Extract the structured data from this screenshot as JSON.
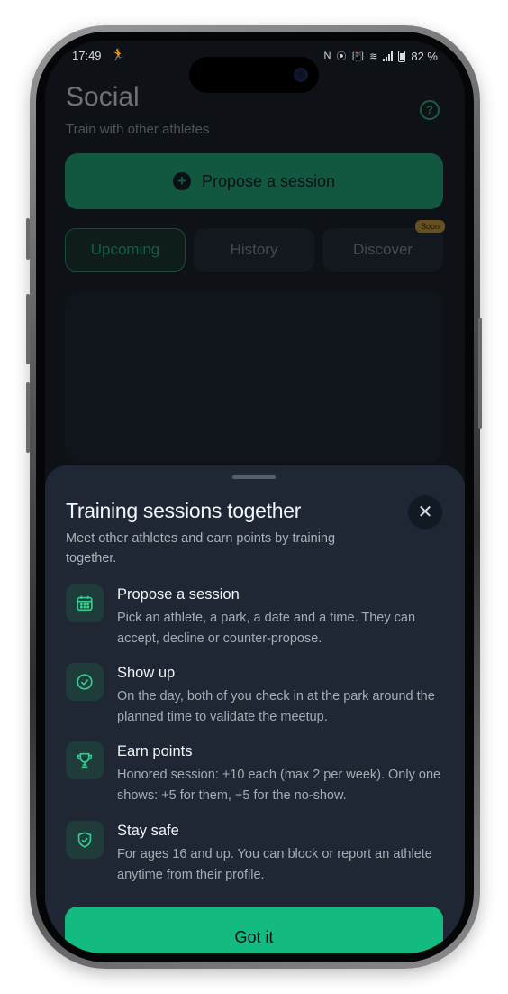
{
  "status_bar": {
    "time": "17:49",
    "runner_glyph": "🏃",
    "nfc_glyph": "N",
    "location_glyph": "⦿",
    "vibrate_glyph": "📳",
    "wifi_glyph": "≋",
    "battery": "82 %"
  },
  "header": {
    "title": "Social",
    "subtitle": "Train with other athletes",
    "help_glyph": "?"
  },
  "propose": {
    "label": "Propose a session",
    "icon_glyph": "+"
  },
  "tabs": [
    {
      "label": "Upcoming",
      "active": true
    },
    {
      "label": "History",
      "active": false
    },
    {
      "label": "Discover",
      "active": false,
      "badge": "Soon"
    }
  ],
  "sheet": {
    "title": "Training sessions together",
    "subtitle": "Meet other athletes and earn points by training together.",
    "close_glyph": "✕",
    "items": [
      {
        "icon": "calendar-icon",
        "title": "Propose a session",
        "description": "Pick an athlete, a park, a date and a time. They can accept, decline or counter-propose."
      },
      {
        "icon": "check-circle-icon",
        "title": "Show up",
        "description": "On the day, both of you check in at the park around the planned time to validate the meetup."
      },
      {
        "icon": "trophy-icon",
        "title": "Earn points",
        "description": "Honored session: +10 each (max 2 per week). Only one shows: +5 for them, −5 for the no-show."
      },
      {
        "icon": "shield-check-icon",
        "title": "Stay safe",
        "description": "For ages 16 and up. You can block or report an athlete anytime from their profile."
      }
    ],
    "button_label": "Got it"
  },
  "colors": {
    "accent": "#13bb80",
    "sheet_bg": "#1e2733",
    "screen_bg": "#0e1217",
    "badge": "#e0a62a"
  }
}
